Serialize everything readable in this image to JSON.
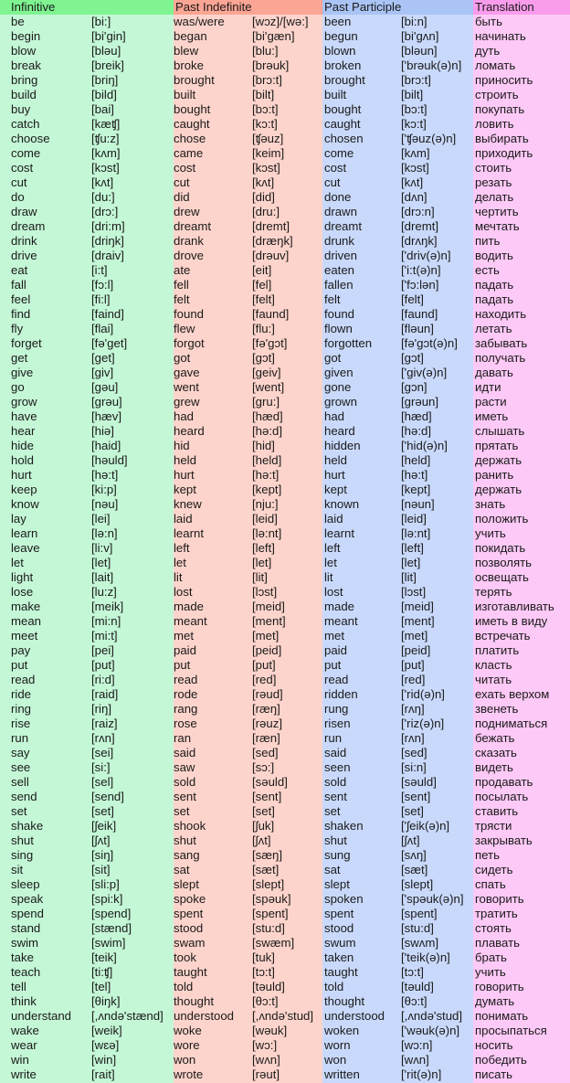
{
  "headers": {
    "infinitive": "Infinitive",
    "past_indefinite": "Past Indefinite",
    "past_participle": "Past Participle",
    "translation": "Translation"
  },
  "colors": {
    "infinitive_header": "#7ff491",
    "infinitive_body": "#c4f7d6",
    "past_indefinite_header": "#fba594",
    "past_indefinite_body": "#fdd4cb",
    "past_participle_header": "#aac4f5",
    "past_participle_body": "#c9d9fb",
    "translation_header": "#fa9cec",
    "translation_body": "#fdc9f6"
  },
  "rows": [
    [
      "be",
      "[bi:]",
      "was/were",
      "[wɔz]/[wə:]",
      "been",
      "[bi:n]",
      "быть"
    ],
    [
      "begin",
      "[bi'gin]",
      "began",
      "[bi'gæn]",
      "begun",
      "[bi'gʌn]",
      "начинать"
    ],
    [
      "blow",
      "[bləu]",
      "blew",
      "[blu:]",
      "blown",
      "[bləun]",
      "дуть"
    ],
    [
      "break",
      "[breik]",
      "broke",
      "[brəuk]",
      "broken",
      "['brəuk(ə)n]",
      "ломать"
    ],
    [
      "bring",
      "[briŋ]",
      "brought",
      "[brɔ:t]",
      "brought",
      "[brɔ:t]",
      "приносить"
    ],
    [
      "build",
      "[bild]",
      "built",
      "[bilt]",
      "built",
      "[bilt]",
      "строить"
    ],
    [
      "buy",
      "[bai]",
      "bought",
      "[bɔ:t]",
      "bought",
      "[bɔ:t]",
      "покупать"
    ],
    [
      "catch",
      "[kæʧ]",
      "caught",
      "[kɔ:t]",
      "caught",
      "[kɔ:t]",
      "ловить"
    ],
    [
      "choose",
      "[ʧu:z]",
      "chose",
      "[ʧəuz]",
      "chosen",
      "['ʧəuz(ə)n]",
      "выбирать"
    ],
    [
      "come",
      "[kʌm]",
      "came",
      "[keim]",
      "come",
      "[kʌm]",
      "приходить"
    ],
    [
      "cost",
      "[kɔst]",
      "cost",
      "[kɔst]",
      "cost",
      "[kɔst]",
      "стоить"
    ],
    [
      "cut",
      "[kʌt]",
      "cut",
      "[kʌt]",
      "cut",
      "[kʌt]",
      "резать"
    ],
    [
      "do",
      "[du:]",
      "did",
      "[did]",
      "done",
      "[dʌn]",
      "делать"
    ],
    [
      "draw",
      "[drɔ:]",
      "drew",
      "[dru:]",
      "drawn",
      "[drɔ:n]",
      "чертить"
    ],
    [
      "dream",
      "[dri:m]",
      "dreamt",
      "[dremt]",
      "dreamt",
      "[dremt]",
      "мечтать"
    ],
    [
      "drink",
      "[driŋk]",
      "drank",
      "[dræŋk]",
      "drunk",
      "[drʌŋk]",
      "пить"
    ],
    [
      "drive",
      "[draiv]",
      "drove",
      "[drəuv]",
      "driven",
      "['driv(ə)n]",
      "водить"
    ],
    [
      "eat",
      "[i:t]",
      "ate",
      "[eit]",
      "eaten",
      "['i:t(ə)n]",
      "есть"
    ],
    [
      "fall",
      "[fɔ:l]",
      "fell",
      "[fel]",
      "fallen",
      "['fɔ:lən]",
      "падать"
    ],
    [
      "feel",
      "[fi:l]",
      "felt",
      "[felt]",
      "felt",
      "[felt]",
      "падать"
    ],
    [
      "find",
      "[faind]",
      "found",
      "[faund]",
      "found",
      "[faund]",
      "находить"
    ],
    [
      "fly",
      "[flai]",
      "flew",
      "[flu:]",
      "flown",
      "[fləun]",
      "летать"
    ],
    [
      "forget",
      "[fə'get]",
      "forgot",
      "[fə'gɔt]",
      "forgotten",
      "[fə'gɔt(ə)n]",
      "забывать"
    ],
    [
      "get",
      "[get]",
      "got",
      "[gɔt]",
      "got",
      "[gɔt]",
      "получать"
    ],
    [
      "give",
      "[giv]",
      "gave",
      "[geiv]",
      "given",
      "['giv(ə)n]",
      "давать"
    ],
    [
      "go",
      "[gəu]",
      "went",
      "[went]",
      "gone",
      "[gɔn]",
      "идти"
    ],
    [
      "grow",
      "[grəu]",
      "grew",
      "[gru:]",
      "grown",
      "[grəun]",
      "расти"
    ],
    [
      "have",
      "[hæv]",
      "had",
      "[hæd]",
      "had",
      "[hæd]",
      "иметь"
    ],
    [
      "hear",
      "[hiə]",
      "heard",
      "[hə:d]",
      "heard",
      "[hə:d]",
      "слышать"
    ],
    [
      "hide",
      "[haid]",
      "hid",
      "[hid]",
      "hidden",
      "['hid(ə)n]",
      "прятать"
    ],
    [
      "hold",
      "[həuld]",
      "held",
      "[held]",
      "held",
      "[held]",
      "держать"
    ],
    [
      "hurt",
      "[hə:t]",
      "hurt",
      "[hə:t]",
      "hurt",
      "[hə:t]",
      "ранить"
    ],
    [
      "keep",
      "[ki:p]",
      "kept",
      "[kept]",
      "kept",
      "[kept]",
      "держать"
    ],
    [
      "know",
      "[nəu]",
      "knew",
      "[nju:]",
      "known",
      "[nəun]",
      "знать"
    ],
    [
      "lay",
      "[lei]",
      "laid",
      "[leid]",
      "laid",
      "[leid]",
      "положить"
    ],
    [
      "learn",
      "[lə:n]",
      "learnt",
      "[lə:nt]",
      "learnt",
      "[lə:nt]",
      "учить"
    ],
    [
      "leave",
      "[li:v]",
      "left",
      "[left]",
      "left",
      "[left]",
      "покидать"
    ],
    [
      "let",
      "[let]",
      "let",
      "[let]",
      "let",
      "[let]",
      "позволять"
    ],
    [
      "light",
      "[lait]",
      "lit",
      "[lit]",
      "lit",
      "[lit]",
      "освещать"
    ],
    [
      "lose",
      "[lu:z]",
      "lost",
      "[lɔst]",
      "lost",
      "[lɔst]",
      "терять"
    ],
    [
      "make",
      "[meik]",
      "made",
      "[meid]",
      "made",
      "[meid]",
      "изготавливать"
    ],
    [
      "mean",
      "[mi:n]",
      "meant",
      "[ment]",
      "meant",
      "[ment]",
      "иметь в виду"
    ],
    [
      "meet",
      "[mi:t]",
      "met",
      "[met]",
      "met",
      "[met]",
      "встречать"
    ],
    [
      "pay",
      "[pei]",
      "paid",
      "[peid]",
      "paid",
      "[peid]",
      "платить"
    ],
    [
      "put",
      "[put]",
      "put",
      "[put]",
      "put",
      "[put]",
      "класть"
    ],
    [
      "read",
      "[ri:d]",
      "read",
      "[red]",
      "read",
      "[red]",
      "читать"
    ],
    [
      "ride",
      "[raid]",
      "rode",
      "[rəud]",
      "ridden",
      "['rid(ə)n]",
      "ехать верхом"
    ],
    [
      "ring",
      "[riŋ]",
      "rang",
      "[ræŋ]",
      "rung",
      "[rʌŋ]",
      "звенеть"
    ],
    [
      "rise",
      "[raiz]",
      "rose",
      "[rəuz]",
      "risen",
      "['riz(ə)n]",
      "подниматься"
    ],
    [
      "run",
      "[rʌn]",
      "ran",
      "[ræn]",
      "run",
      "[rʌn]",
      "бежать"
    ],
    [
      "say",
      "[sei]",
      "said",
      "[sed]",
      "said",
      "[sed]",
      "сказать"
    ],
    [
      "see",
      "[si:]",
      "saw",
      "[sɔ:]",
      "seen",
      "[si:n]",
      "видеть"
    ],
    [
      "sell",
      "[sel]",
      "sold",
      "[səuld]",
      "sold",
      "[səuld]",
      "продавать"
    ],
    [
      "send",
      "[send]",
      "sent",
      "[sent]",
      "sent",
      "[sent]",
      "посылать"
    ],
    [
      "set",
      "[set]",
      "set",
      "[set]",
      "set",
      "[set]",
      "ставить"
    ],
    [
      "shake",
      "[ʃeik]",
      "shook",
      "[ʃuk]",
      "shaken",
      "['ʃeik(ə)n]",
      "трясти"
    ],
    [
      "shut",
      "[ʃʌt]",
      "shut",
      "[ʃʌt]",
      "shut",
      "[ʃʌt]",
      "закрывать"
    ],
    [
      "sing",
      "[siŋ]",
      "sang",
      "[sæŋ]",
      "sung",
      "[sʌŋ]",
      "петь"
    ],
    [
      "sit",
      "[sit]",
      "sat",
      "[sæt]",
      "sat",
      "[sæt]",
      "сидеть"
    ],
    [
      "sleep",
      "[sli:p]",
      "slept",
      "[slept]",
      "slept",
      "[slept]",
      "спать"
    ],
    [
      "speak",
      "[spi:k]",
      "spoke",
      "[spəuk]",
      "spoken",
      "['spəuk(ə)n]",
      "говорить"
    ],
    [
      "spend",
      "[spend]",
      "spent",
      "[spent]",
      "spent",
      "[spent]",
      "тратить"
    ],
    [
      "stand",
      "[stænd]",
      "stood",
      "[stu:d]",
      "stood",
      "[stu:d]",
      "стоять"
    ],
    [
      "swim",
      "[swim]",
      "swam",
      "[swæm]",
      "swum",
      "[swʌm]",
      "плавать"
    ],
    [
      "take",
      "[teik]",
      "took",
      "[tuk]",
      "taken",
      "['teik(ə)n]",
      "брать"
    ],
    [
      "teach",
      "[ti:ʧ]",
      "taught",
      "[tɔ:t]",
      "taught",
      "[tɔ:t]",
      "учить"
    ],
    [
      "tell",
      "[tel]",
      "told",
      "[təuld]",
      "told",
      "[təuld]",
      "говорить"
    ],
    [
      "think",
      "[θiŋk]",
      "thought",
      "[θɔ:t]",
      "thought",
      "[θɔ:t]",
      "думать"
    ],
    [
      "understand",
      "[,ʌndə'stænd]",
      "understood",
      "[,ʌndə'stud]",
      "understood",
      "[,ʌndə'stud]",
      "понимать"
    ],
    [
      "wake",
      "[weik]",
      "woke",
      "[wəuk]",
      "woken",
      "['wəuk(ə)n]",
      "просыпаться"
    ],
    [
      "wear",
      "[wɛə]",
      "wore",
      "[wɔ:]",
      "worn",
      "[wɔ:n]",
      "носить"
    ],
    [
      "win",
      "[win]",
      "won",
      "[wʌn]",
      "won",
      "[wʌn]",
      "победить"
    ],
    [
      "write",
      "[rait]",
      "wrote",
      "[rəut]",
      "written",
      "['rit(ə)n]",
      "писать"
    ]
  ]
}
